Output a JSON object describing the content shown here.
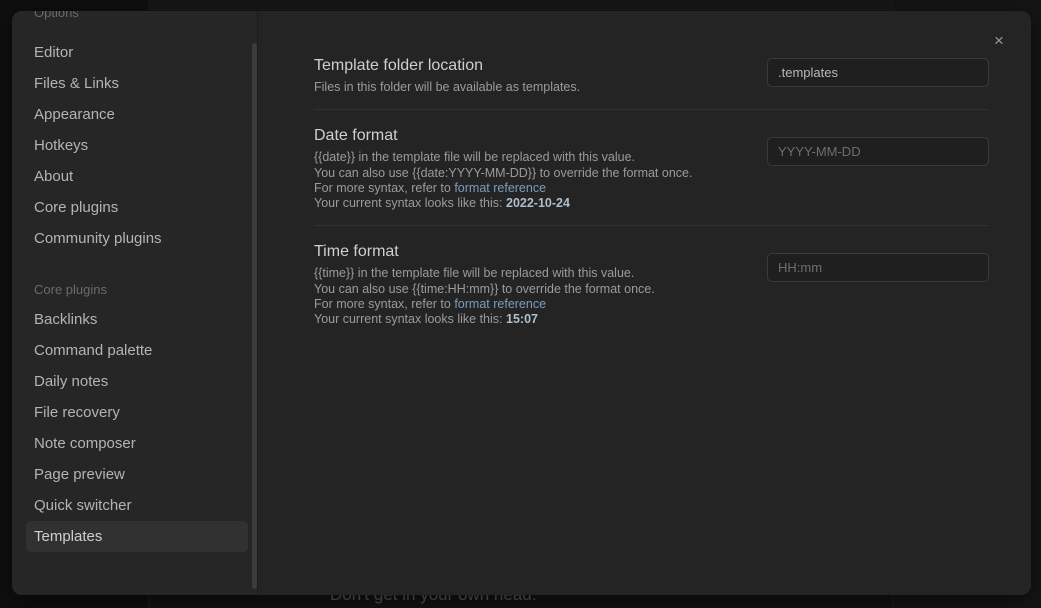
{
  "background": {
    "note_text": "Don't get in your own head."
  },
  "modal": {
    "close_icon": "close-icon",
    "close_label": "×",
    "sidebar": {
      "options_header": "Options",
      "primary_items": [
        {
          "label": "Editor",
          "selected": false
        },
        {
          "label": "Files & Links",
          "selected": false
        },
        {
          "label": "Appearance",
          "selected": false
        },
        {
          "label": "Hotkeys",
          "selected": false
        },
        {
          "label": "About",
          "selected": false
        },
        {
          "label": "Core plugins",
          "selected": false
        },
        {
          "label": "Community plugins",
          "selected": false
        }
      ],
      "core_plugins_header": "Core plugins",
      "core_plugin_items": [
        {
          "label": "Backlinks",
          "selected": false
        },
        {
          "label": "Command palette",
          "selected": false
        },
        {
          "label": "Daily notes",
          "selected": false
        },
        {
          "label": "File recovery",
          "selected": false
        },
        {
          "label": "Note composer",
          "selected": false
        },
        {
          "label": "Page preview",
          "selected": false
        },
        {
          "label": "Quick switcher",
          "selected": false
        },
        {
          "label": "Templates",
          "selected": true
        }
      ]
    },
    "settings": [
      {
        "id": "template-folder",
        "name": "Template folder location",
        "desc_lines": [
          [
            {
              "text": "Files in this folder will be available as templates.",
              "style": "normal"
            }
          ]
        ],
        "input": {
          "value": ".templates",
          "placeholder": ""
        }
      },
      {
        "id": "date-format",
        "name": "Date format",
        "desc_lines": [
          [
            {
              "text": "{{date}} in the template file will be replaced with this value.",
              "style": "normal"
            }
          ],
          [
            {
              "text": "You can also use {{date:YYYY-MM-DD}} to override the format once.",
              "style": "normal"
            }
          ],
          [
            {
              "text": "For more syntax, refer to ",
              "style": "normal"
            },
            {
              "text": "format reference",
              "style": "link"
            }
          ],
          [
            {
              "text": "Your current syntax looks like this: ",
              "style": "normal"
            },
            {
              "text": "2022-10-24",
              "style": "strong"
            }
          ]
        ],
        "input": {
          "value": "",
          "placeholder": "YYYY-MM-DD"
        }
      },
      {
        "id": "time-format",
        "name": "Time format",
        "desc_lines": [
          [
            {
              "text": "{{time}} in the template file will be replaced with this value.",
              "style": "normal"
            }
          ],
          [
            {
              "text": "You can also use {{time:HH:mm}} to override the format once.",
              "style": "normal"
            }
          ],
          [
            {
              "text": "For more syntax, refer to ",
              "style": "normal"
            },
            {
              "text": "format reference",
              "style": "link"
            }
          ],
          [
            {
              "text": "Your current syntax looks like this: ",
              "style": "normal"
            },
            {
              "text": "15:07",
              "style": "strong"
            }
          ]
        ],
        "input": {
          "value": "",
          "placeholder": "HH:mm"
        }
      }
    ]
  },
  "colors": {
    "modal_bg": "#242424",
    "sidebar_bg": "#262626",
    "selected_item_bg": "#313131",
    "link": "#7e9cb8",
    "text_primary": "#cfcfcf",
    "text_muted": "#9b9b9b",
    "text_dim": "#6a6a6a"
  }
}
